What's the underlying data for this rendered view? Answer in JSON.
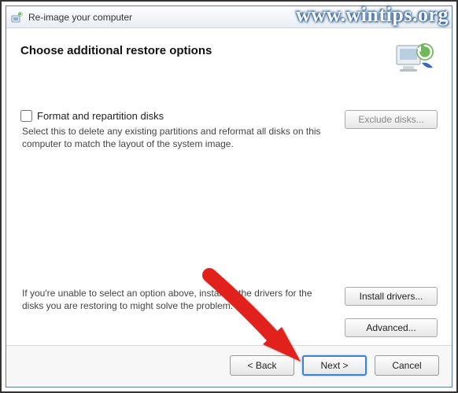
{
  "titlebar": {
    "title": "Re-image your computer"
  },
  "header": {
    "heading": "Choose additional restore options"
  },
  "format_section": {
    "checkbox_label": "Format and repartition disks",
    "description": "Select this to delete any existing partitions and reformat all disks on this computer to match the layout of the system image.",
    "exclude_button": "Exclude disks..."
  },
  "drivers_section": {
    "description": "If you're unable to select an option above, installing the drivers for the disks you are restoring to might solve the problem.",
    "install_button": "Install drivers...",
    "advanced_button": "Advanced..."
  },
  "footer": {
    "back": "< Back",
    "next": "Next >",
    "cancel": "Cancel"
  },
  "watermark": "www.wintips.org",
  "colors": {
    "accent": "#3b82d0",
    "arrow": "#e1201f"
  }
}
